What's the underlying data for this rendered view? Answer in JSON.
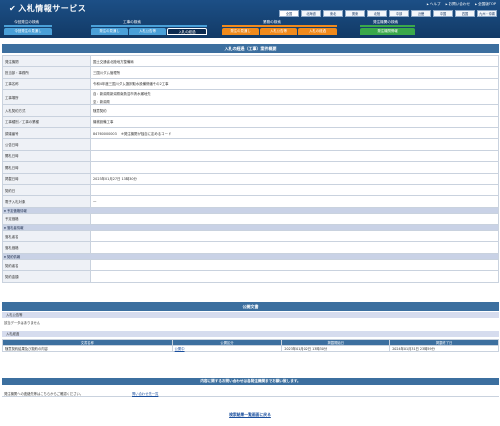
{
  "app": {
    "title": "入札情報サービス"
  },
  "top_links": [
    "ヘルプ",
    "お問い合わせ",
    "全国版TOP"
  ],
  "regions": [
    {
      "label": "全国",
      "selected": true
    },
    {
      "label": "北海道"
    },
    {
      "label": "東北"
    },
    {
      "label": "関東"
    },
    {
      "label": "北陸"
    },
    {
      "label": "中部"
    },
    {
      "label": "近畿"
    },
    {
      "label": "中国"
    },
    {
      "label": "四国"
    },
    {
      "label": "九州・沖縄"
    }
  ],
  "categories": {
    "subscriber": "今回発注の検索",
    "construction": "工事の検索",
    "consulting": "業務の検索",
    "orderer": "発注機関の検索"
  },
  "tabs": {
    "t1": "今回発注の見通し",
    "t2": "発注の見通し",
    "t3": "入札公告等",
    "t4": "入札の経過",
    "t5": "発注の見通し",
    "t6": "入札公告等",
    "t7": "入札の経過",
    "t8": "発注機関情報"
  },
  "detail": {
    "heading": "入札の経過（工事）案件概要",
    "rows": {
      "agency_label": "発注機関",
      "agency": "国土交通省北陸地方整備局",
      "office_label": "担当部・事務所",
      "office": "三国川ダム管理所",
      "name_label": "工事名称",
      "name": "令和4年度三国川ダム選択取水設備修繕その2工事",
      "place_label": "工事場所",
      "place1": "自：新潟県新潟県南魚沼市清水瀬地先",
      "place2": "至：新潟県",
      "method_label": "入札契約方式",
      "method": "随意契約",
      "type_label": "工事種別／工事の業種",
      "type": "機械設備工事",
      "code_label": "調達番号",
      "code": "84760000003",
      "code_note": "※発注機関が独自に定めるコード",
      "public_label": "公告日時",
      "bid_label": "開札日時",
      "open_label": "開札日時",
      "publish_label": "掲載日時",
      "publish": "2023年01月27日 13時30分",
      "contract_label": "契約日",
      "edoc_label": "電子入札対象",
      "edoc": "一",
      "sec_price": "予定価格情報",
      "price_label": "予定価格",
      "sec_winner": "落札者情報",
      "winner_name_label": "落札者名",
      "winner_price_label": "落札価格",
      "sec_contract": "契約情報",
      "contractor_label": "契約者名",
      "amount_label": "契約金額"
    }
  },
  "docs": {
    "heading": "公開文書",
    "notice_sec": "入札公告等",
    "notice_empty": "該当データはありません",
    "result_sec": "入札経過",
    "columns": [
      "文書名称",
      "公開区分",
      "掲載開始日",
      "掲載終了日"
    ],
    "rows": [
      {
        "name": "随意契約結果及び契約の内容",
        "kind": "公開中",
        "start": "2023年01月02日 13時30分",
        "end": "2024年01月31日 23時59分"
      }
    ]
  },
  "contact": {
    "heading": "内容に関するお問い合わせは各発注機関までお願い致します。",
    "text": "発注機関への連絡先等はこちらからご確認ください。",
    "link": "問い合わせ先一覧"
  },
  "back_link": "検索結果一覧画面に戻る"
}
